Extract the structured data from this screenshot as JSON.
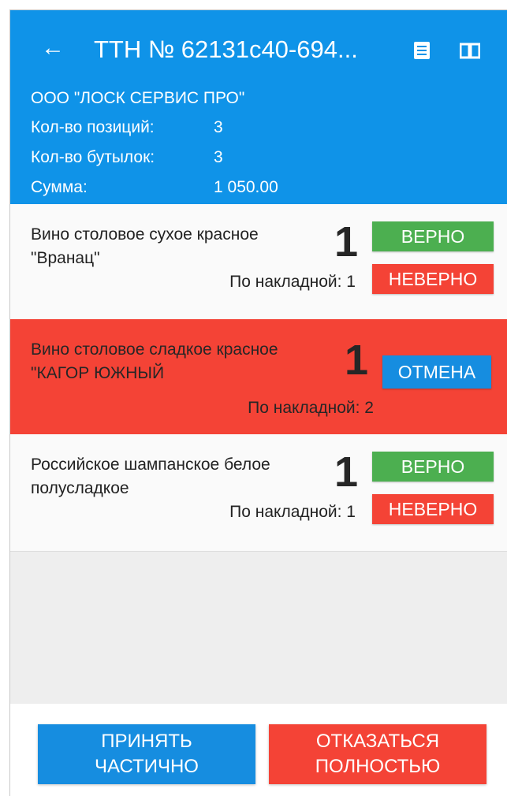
{
  "header": {
    "title": "ТТН № 62131c40-694...",
    "icons": {
      "back": "arrow-left-icon",
      "document": "document-icon",
      "book": "book-icon"
    },
    "company": "ООО \"ЛОСК СЕРВИС ПРО\"",
    "positions_label": "Кол-во позиций:",
    "positions_value": "3",
    "bottles_label": "Кол-во бутылок:",
    "bottles_value": "3",
    "sum_label": "Сумма:",
    "sum_value": "1 050.00"
  },
  "items": [
    {
      "name": "Вино столовое сухое красное \"Вранац\"",
      "quantity": "1",
      "invoice": "По накладной: 1",
      "ok_label": "ВЕРНО",
      "bad_label": "НЕВЕРНО"
    },
    {
      "name": "Вино столовое сладкое красное \"КАГОР ЮЖНЫЙ",
      "quantity": "1",
      "invoice": "По накладной: 2",
      "cancel_label": "ОТМЕНА"
    },
    {
      "name": "Российское шампанское белое полусладкое",
      "quantity": "1",
      "invoice": "По накладной: 1",
      "ok_label": "ВЕРНО",
      "bad_label": "НЕВЕРНО"
    }
  ],
  "actions": {
    "accept_line1": "ПРИНЯТЬ",
    "accept_line2": "ЧАСТИЧНО",
    "reject_line1": "ОТКАЗАТЬСЯ",
    "reject_line2": "ПОЛНОСТЬЮ"
  },
  "colors": {
    "header": "#0f93e8",
    "ok": "#4caf50",
    "bad": "#f44336",
    "cancel": "#168de0"
  }
}
